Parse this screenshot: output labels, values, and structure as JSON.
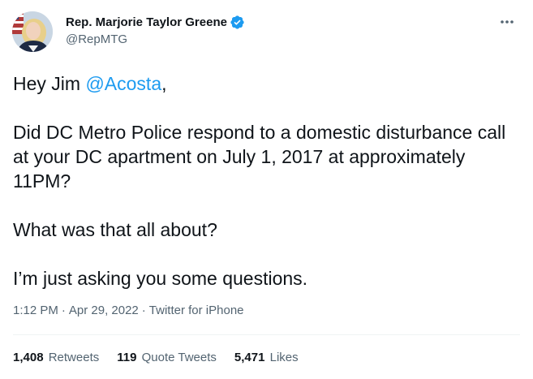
{
  "colors": {
    "accent": "#1d9bf0",
    "text_primary": "#0f1419",
    "text_secondary": "#536471",
    "divider": "#eff3f4"
  },
  "author": {
    "display_name": "Rep. Marjorie Taylor Greene",
    "handle": "@RepMTG",
    "verified_icon": "verified-badge-icon",
    "avatar_icon": "avatar-photo"
  },
  "more_menu_icon": "more-horizontal-icon",
  "tweet": {
    "greeting_prefix": "Hey Jim ",
    "mention": "@Acosta",
    "greeting_suffix": ",",
    "paragraph_2": "Did DC Metro Police respond to a domestic disturbance call at your DC apartment on July 1, 2017 at approximately 11PM?",
    "paragraph_3": "What was that all about?",
    "paragraph_4": "I’m just asking you some questions."
  },
  "meta": {
    "time": "1:12 PM",
    "separator": "·",
    "date": "Apr 29, 2022",
    "source": "Twitter for iPhone"
  },
  "stats": {
    "retweets_count": "1,408",
    "retweets_label": "Retweets",
    "quotes_count": "119",
    "quotes_label": "Quote Tweets",
    "likes_count": "5,471",
    "likes_label": "Likes"
  }
}
